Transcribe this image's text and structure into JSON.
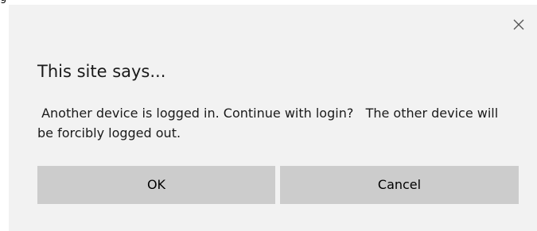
{
  "background_text": "g",
  "dialog": {
    "title": "This site says...",
    "message": " Another device is logged in. Continue with login?   The other device will be forcibly logged out.",
    "ok_label": "OK",
    "cancel_label": "Cancel",
    "close_icon": "close-icon"
  },
  "colors": {
    "dialog_bg": "#f2f2f2",
    "button_bg": "#cccccc",
    "text": "#1a1a1a"
  }
}
